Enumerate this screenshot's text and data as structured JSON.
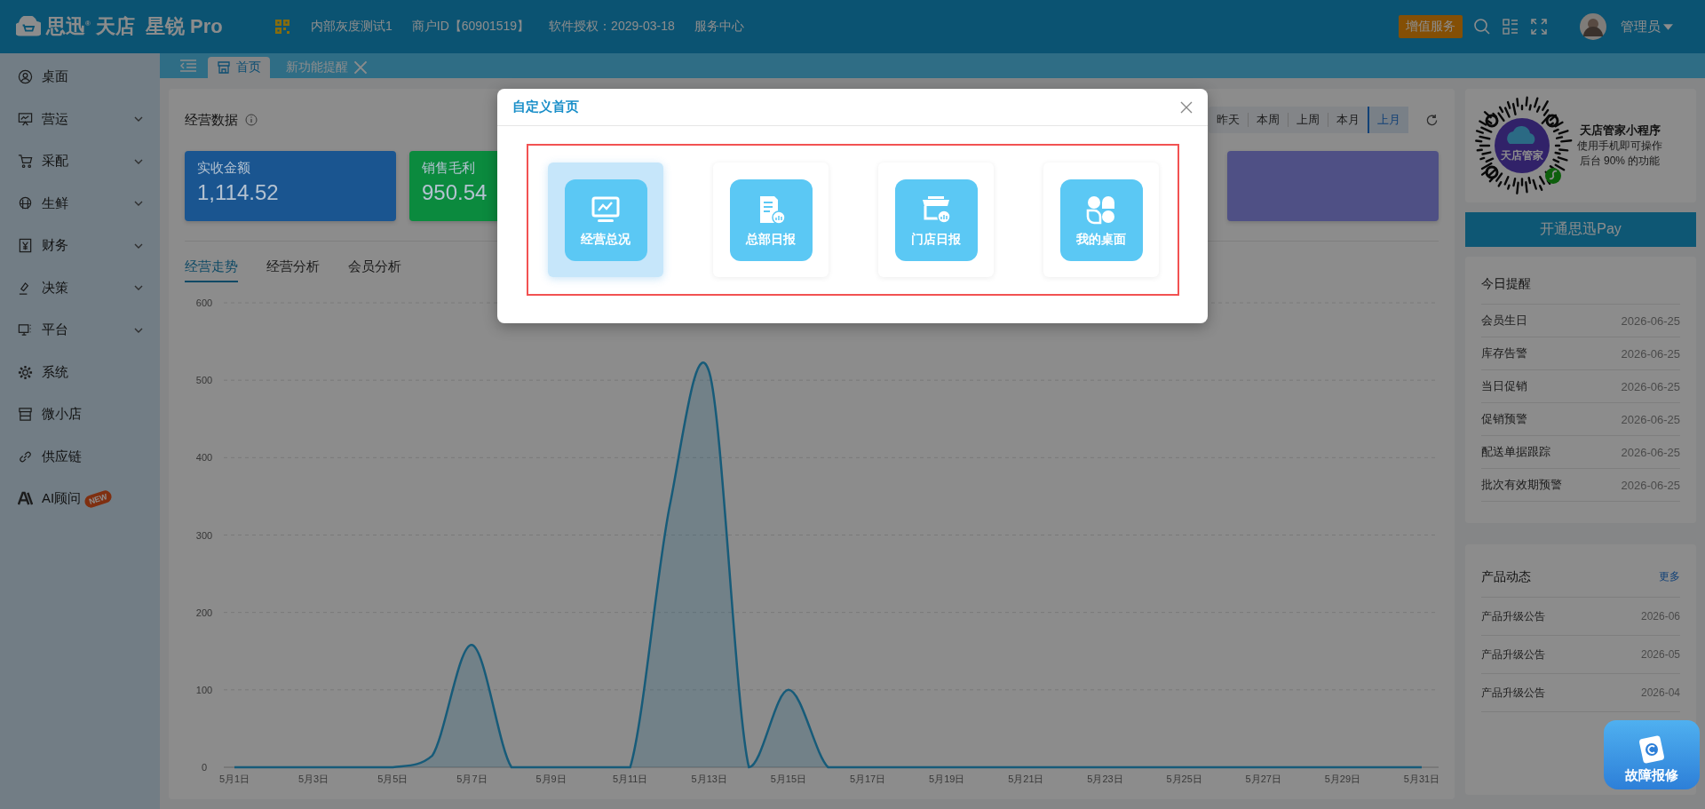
{
  "topbar": {
    "logo": {
      "brand": "思迅$^{®}$",
      "product": "天店",
      "edition": "星锐 Pro"
    },
    "info": [
      "内部灰度测试1",
      "商户ID【60901519】",
      "软件授权：2029-03-18",
      "服务中心"
    ],
    "upgrade_button": "增值服务",
    "user": "管理员"
  },
  "sidebar": {
    "items": [
      {
        "label": "桌面",
        "kind": "link"
      },
      {
        "label": "营运",
        "kind": "group"
      },
      {
        "label": "采配",
        "kind": "group"
      },
      {
        "label": "生鲜",
        "kind": "group"
      },
      {
        "label": "财务",
        "kind": "group"
      },
      {
        "label": "决策",
        "kind": "group"
      },
      {
        "label": "平台",
        "kind": "group"
      },
      {
        "label": "系统",
        "kind": "link"
      },
      {
        "label": "微小店",
        "kind": "link"
      },
      {
        "label": "供应链",
        "kind": "link"
      },
      {
        "label": "AI顾问",
        "kind": "link",
        "badge": "NEW"
      }
    ]
  },
  "tabs": [
    {
      "label": "首页",
      "selected": true,
      "closable": false
    },
    {
      "label": "新功能提醒",
      "selected": false,
      "closable": true
    }
  ],
  "business": {
    "title": "经营数据",
    "ranges": [
      {
        "label": "昨天",
        "selected": false
      },
      {
        "label": "本周",
        "selected": false
      },
      {
        "label": "上周",
        "selected": false
      },
      {
        "label": "本月",
        "selected": false
      },
      {
        "label": "上月",
        "selected": true
      }
    ],
    "cards": [
      {
        "label": "实收金额",
        "value": "1,114.52",
        "color": "#1a5590"
      },
      {
        "label": "销售毛利",
        "value": "950.54",
        "color": "#0b8a3e"
      },
      {
        "color": "#4f5085"
      }
    ],
    "tabs": [
      {
        "label": "经营走势",
        "selected": true
      },
      {
        "label": "经营分析",
        "selected": false
      },
      {
        "label": "会员分析",
        "selected": false
      }
    ],
    "chart_data": {
      "type": "area",
      "categories": [
        "5月1日",
        null,
        "5月3日",
        null,
        "5月5日",
        null,
        "5月7日",
        null,
        "5月9日",
        null,
        "5月11日",
        null,
        "5月13日",
        null,
        "5月15日",
        null,
        "5月17日",
        null,
        "5月19日",
        null,
        "5月21日",
        null,
        "5月23日",
        null,
        "5月25日",
        null,
        "5月27日",
        null,
        "5月29日",
        null,
        "5月31日"
      ],
      "series": [
        {
          "color": "#2aa6dc",
          "values": [
            0,
            0,
            0,
            0,
            0,
            15,
            158,
            0,
            0,
            0,
            0,
            338,
            510,
            0,
            100,
            0,
            0,
            0,
            0,
            0,
            0,
            0,
            0,
            0,
            0,
            0,
            0,
            0,
            0,
            0,
            0
          ]
        }
      ],
      "ylim": [
        0,
        600
      ],
      "yticks": [
        0,
        100,
        200,
        300,
        400,
        500,
        600
      ],
      "grid": true
    }
  },
  "aside": {
    "mini_program": {
      "logo_text": "天店管家",
      "title": "天店管家小程序",
      "lines": [
        "使用手机即可操作",
        "后台 90% 的功能"
      ]
    },
    "pay_button": "开通思迅Pay",
    "reminders": {
      "title": "今日提醒",
      "rows": [
        {
          "label": "会员生日",
          "date": "2026-06-25"
        },
        {
          "label": "库存告警",
          "date": "2026-06-25"
        },
        {
          "label": "当日促销",
          "date": "2026-06-25"
        },
        {
          "label": "促销预警",
          "date": "2026-06-25"
        },
        {
          "label": "配送单据跟踪",
          "date": "2026-06-25"
        },
        {
          "label": "批次有效期预警",
          "date": "2026-06-25"
        }
      ]
    },
    "news": {
      "title": "产品动态",
      "more": "更多",
      "rows": [
        {
          "label": "产品升级公告",
          "date": "2026-06"
        },
        {
          "label": "产品升级公告",
          "date": "2026-05"
        },
        {
          "label": "产品升级公告",
          "date": "2026-04"
        }
      ]
    }
  },
  "help_button": "故障报修",
  "modal": {
    "title": "自定义首页",
    "highlighted": true,
    "options": [
      {
        "label": "经营总况",
        "kind": "overview",
        "selected": true
      },
      {
        "label": "总部日报",
        "kind": "hq",
        "selected": false
      },
      {
        "label": "门店日报",
        "kind": "store",
        "selected": false
      },
      {
        "label": "我的桌面",
        "kind": "desktop",
        "selected": false
      }
    ]
  }
}
